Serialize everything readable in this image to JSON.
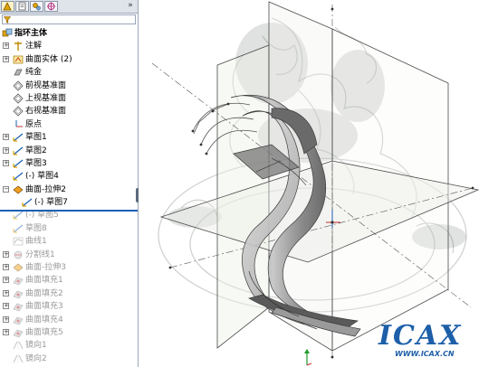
{
  "tabs": [
    {
      "name": "feature-manager",
      "icon": "feature-manager-icon"
    },
    {
      "name": "property-manager",
      "icon": "property-manager-icon"
    },
    {
      "name": "configuration-manager",
      "icon": "configuration-manager-icon"
    },
    {
      "name": "dimxpert-manager",
      "icon": "dimxpert-icon"
    }
  ],
  "more_label": "»",
  "tree": {
    "root": "指环主体",
    "items": [
      {
        "label": "注解",
        "icon": "annotation-icon",
        "expander": true,
        "dim": false
      },
      {
        "label": "曲面实体 (2)",
        "icon": "surface-bodies-icon",
        "expander": true,
        "dim": false
      },
      {
        "label": "纯金",
        "icon": "material-icon",
        "expander": false,
        "dim": false
      },
      {
        "label": "前视基准面",
        "icon": "plane-icon",
        "expander": false,
        "dim": false
      },
      {
        "label": "上视基准面",
        "icon": "plane-icon",
        "expander": false,
        "dim": false
      },
      {
        "label": "右视基准面",
        "icon": "plane-icon",
        "expander": false,
        "dim": false
      },
      {
        "label": "原点",
        "icon": "origin-icon",
        "expander": false,
        "dim": false
      },
      {
        "label": "草图1",
        "icon": "sketch-icon",
        "expander": true,
        "dim": false
      },
      {
        "label": "草图2",
        "icon": "sketch-icon",
        "expander": true,
        "dim": false
      },
      {
        "label": "草图3",
        "icon": "sketch-icon",
        "expander": true,
        "dim": false
      },
      {
        "label": "(-) 草图4",
        "icon": "sketch-icon",
        "expander": false,
        "dim": false
      },
      {
        "label": "曲面-拉伸2",
        "icon": "surface-extrude-icon",
        "expander": true,
        "dim": false,
        "open": true
      },
      {
        "label": "(-) 草图7",
        "icon": "sketch-icon",
        "expander": false,
        "dim": false,
        "indent": true
      },
      {
        "label": "(-) 草图5",
        "icon": "sketch-icon",
        "expander": false,
        "dim": true
      },
      {
        "label": "草图8",
        "icon": "sketch-icon",
        "expander": false,
        "dim": true
      },
      {
        "label": "曲线1",
        "icon": "curve-icon",
        "expander": false,
        "dim": true
      },
      {
        "label": "分割线1",
        "icon": "split-line-icon",
        "expander": true,
        "dim": true
      },
      {
        "label": "曲面-拉伸3",
        "icon": "surface-extrude-icon",
        "expander": true,
        "dim": true
      },
      {
        "label": "曲面填充1",
        "icon": "surface-fill-icon",
        "expander": true,
        "dim": true
      },
      {
        "label": "曲面填充2",
        "icon": "surface-fill-icon",
        "expander": true,
        "dim": true
      },
      {
        "label": "曲面填充3",
        "icon": "surface-fill-icon",
        "expander": true,
        "dim": true
      },
      {
        "label": "曲面填充4",
        "icon": "surface-fill-icon",
        "expander": true,
        "dim": true
      },
      {
        "label": "曲面填充5",
        "icon": "surface-fill-icon",
        "expander": true,
        "dim": true
      },
      {
        "label": "镜向1",
        "icon": "mirror-icon",
        "expander": false,
        "dim": true
      },
      {
        "label": "镜向2",
        "icon": "mirror-icon",
        "expander": false,
        "dim": true
      }
    ]
  },
  "watermark": {
    "logo": "ICAX",
    "url": "WWW.ICAX.CN"
  },
  "colors": {
    "accent": "#1b5fb3",
    "plane_edge": "#4a4a4a",
    "surface": "#8e8e8e",
    "watermark": "#1d5fa8"
  }
}
